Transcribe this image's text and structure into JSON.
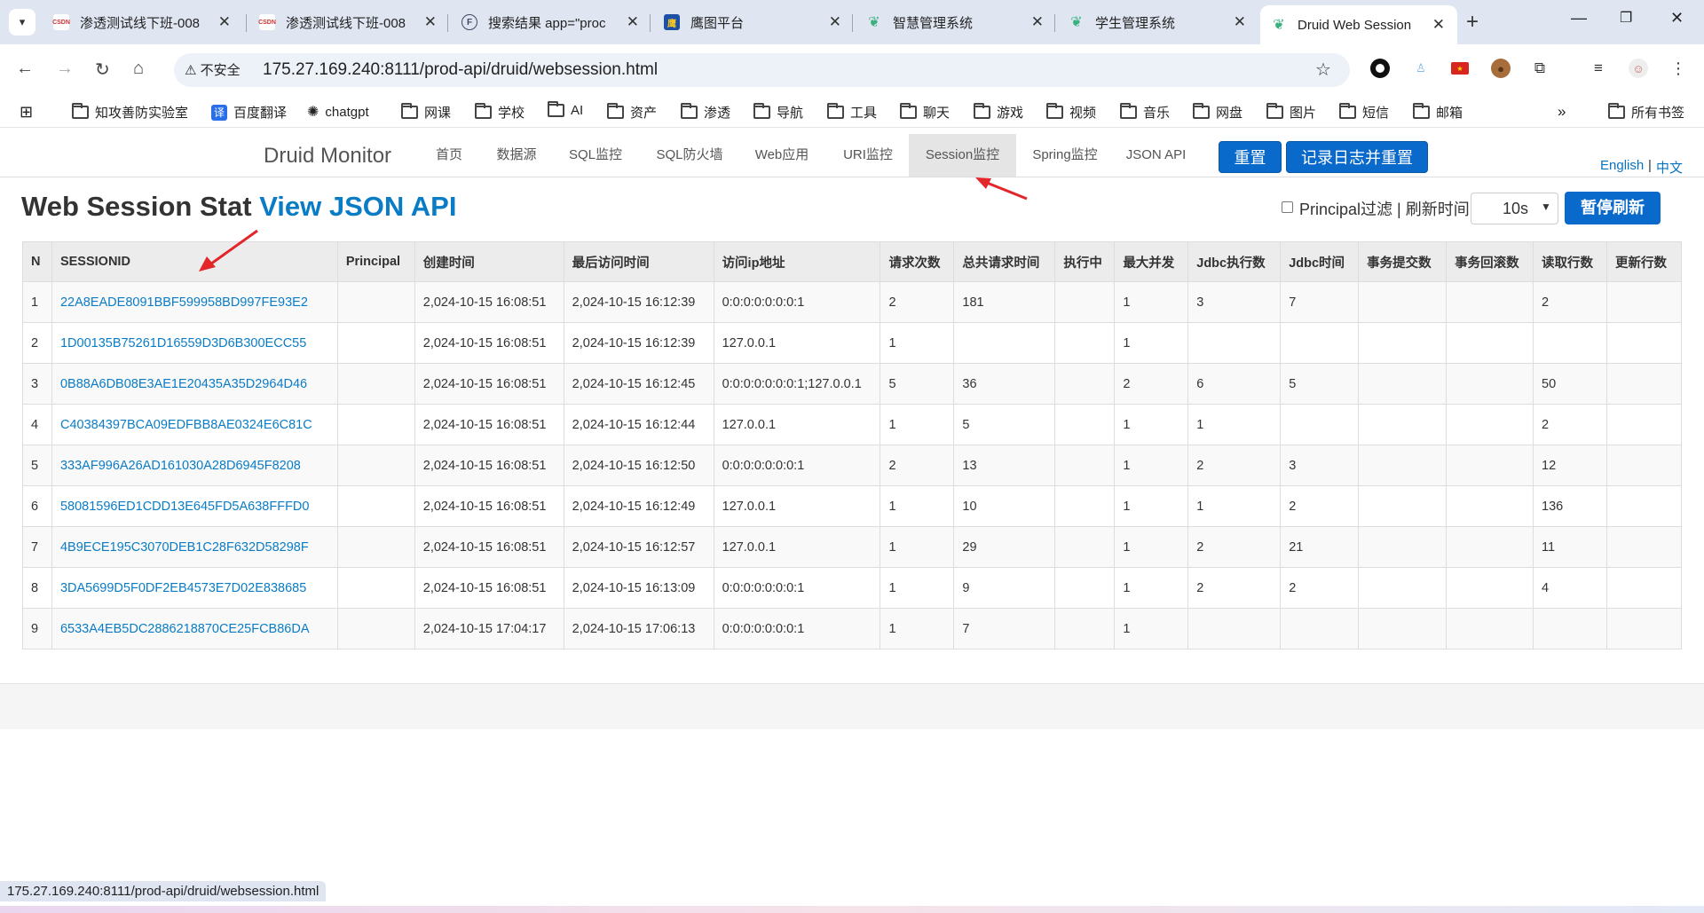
{
  "browser": {
    "tabs": [
      {
        "title": "渗透测试线下班-008",
        "favicon": "csdn"
      },
      {
        "title": "渗透测试线下班-008",
        "favicon": "csdn"
      },
      {
        "title": "搜索结果 app=\"proc",
        "favicon": "fofa"
      },
      {
        "title": "鹰图平台",
        "favicon": "hunter"
      },
      {
        "title": "智慧管理系统",
        "favicon": "vue"
      },
      {
        "title": "学生管理系统",
        "favicon": "vue"
      },
      {
        "title": "Druid Web Session",
        "favicon": "vue",
        "active": true
      }
    ],
    "address": {
      "security_label": "不安全",
      "url": "175.27.169.240:8111/prod-api/druid/websession.html"
    },
    "bookmarks": [
      {
        "label": "知攻善防实验室",
        "icon": "folder-icon"
      },
      {
        "label": "百度翻译",
        "icon": "translate-icon"
      },
      {
        "label": "chatgpt",
        "icon": "openai-icon"
      },
      {
        "label": "网课",
        "icon": "folder-icon"
      },
      {
        "label": "学校",
        "icon": "folder-icon"
      },
      {
        "label": "AI",
        "icon": "folder-icon"
      },
      {
        "label": "资产",
        "icon": "folder-icon"
      },
      {
        "label": "渗透",
        "icon": "folder-icon"
      },
      {
        "label": "导航",
        "icon": "folder-icon"
      },
      {
        "label": "工具",
        "icon": "folder-icon"
      },
      {
        "label": "聊天",
        "icon": "folder-icon"
      },
      {
        "label": "游戏",
        "icon": "folder-icon"
      },
      {
        "label": "视频",
        "icon": "folder-icon"
      },
      {
        "label": "音乐",
        "icon": "folder-icon"
      },
      {
        "label": "网盘",
        "icon": "folder-icon"
      },
      {
        "label": "图片",
        "icon": "folder-icon"
      },
      {
        "label": "短信",
        "icon": "folder-icon"
      },
      {
        "label": "邮箱",
        "icon": "folder-icon"
      }
    ],
    "all_bookmarks": "所有书签",
    "status_url": "175.27.169.240:8111/prod-api/druid/websession.html"
  },
  "druid": {
    "brand": "Druid Monitor",
    "nav": [
      "首页",
      "数据源",
      "SQL监控",
      "SQL防火墙",
      "Web应用",
      "URI监控",
      "Session监控",
      "Spring监控",
      "JSON API"
    ],
    "active_nav": "Session监控",
    "reset_button": "重置",
    "log_reset_button": "记录日志并重置",
    "lang_en": "English",
    "lang_sep": "|",
    "lang_zh": "中文",
    "title": "Web Session Stat",
    "title_link": "View JSON API",
    "filter_label": "Principal过滤 | 刷新时间",
    "refresh_value": "10s",
    "pause_button": "暂停刷新",
    "accent_color": "#0a6acb",
    "link_color": "#0a7cc6"
  },
  "table": {
    "headers": [
      "N",
      "SESSIONID",
      "Principal",
      "创建时间",
      "最后访问时间",
      "访问ip地址",
      "请求次数",
      "总共请求时间",
      "执行中",
      "最大并发",
      "Jdbc执行数",
      "Jdbc时间",
      "事务提交数",
      "事务回滚数",
      "读取行数",
      "更新行数"
    ],
    "rows": [
      [
        "1",
        "22A8EADE8091BBF599958BD997FE93E2",
        "",
        "2,024-10-15 16:08:51",
        "2,024-10-15 16:12:39",
        "0:0:0:0:0:0:0:1",
        "2",
        "181",
        "",
        "1",
        "3",
        "7",
        "",
        "",
        "2",
        ""
      ],
      [
        "2",
        "1D00135B75261D16559D3D6B300ECC55",
        "",
        "2,024-10-15 16:08:51",
        "2,024-10-15 16:12:39",
        "127.0.0.1",
        "1",
        "",
        "",
        "1",
        "",
        "",
        "",
        "",
        "",
        ""
      ],
      [
        "3",
        "0B88A6DB08E3AE1E20435A35D2964D46",
        "",
        "2,024-10-15 16:08:51",
        "2,024-10-15 16:12:45",
        "0:0:0:0:0:0:0:1;127.0.0.1",
        "5",
        "36",
        "",
        "2",
        "6",
        "5",
        "",
        "",
        "50",
        ""
      ],
      [
        "4",
        "C40384397BCA09EDFBB8AE0324E6C81C",
        "",
        "2,024-10-15 16:08:51",
        "2,024-10-15 16:12:44",
        "127.0.0.1",
        "1",
        "5",
        "",
        "1",
        "1",
        "",
        "",
        "",
        "2",
        ""
      ],
      [
        "5",
        "333AF996A26AD161030A28D6945F8208",
        "",
        "2,024-10-15 16:08:51",
        "2,024-10-15 16:12:50",
        "0:0:0:0:0:0:0:1",
        "2",
        "13",
        "",
        "1",
        "2",
        "3",
        "",
        "",
        "12",
        ""
      ],
      [
        "6",
        "58081596ED1CDD13E645FD5A638FFFD0",
        "",
        "2,024-10-15 16:08:51",
        "2,024-10-15 16:12:49",
        "127.0.0.1",
        "1",
        "10",
        "",
        "1",
        "1",
        "2",
        "",
        "",
        "136",
        ""
      ],
      [
        "7",
        "4B9ECE195C3070DEB1C28F632D58298F",
        "",
        "2,024-10-15 16:08:51",
        "2,024-10-15 16:12:57",
        "127.0.0.1",
        "1",
        "29",
        "",
        "1",
        "2",
        "21",
        "",
        "",
        "11",
        ""
      ],
      [
        "8",
        "3DA5699D5F0DF2EB4573E7D02E838685",
        "",
        "2,024-10-15 16:08:51",
        "2,024-10-15 16:13:09",
        "0:0:0:0:0:0:0:1",
        "1",
        "9",
        "",
        "1",
        "2",
        "2",
        "",
        "",
        "4",
        ""
      ],
      [
        "9",
        "6533A4EB5DC2886218870CE25FCB86DA",
        "",
        "2,024-10-15 17:04:17",
        "2,024-10-15 17:06:13",
        "0:0:0:0:0:0:0:1",
        "1",
        "7",
        "",
        "1",
        "",
        "",
        "",
        "",
        "",
        ""
      ]
    ]
  }
}
